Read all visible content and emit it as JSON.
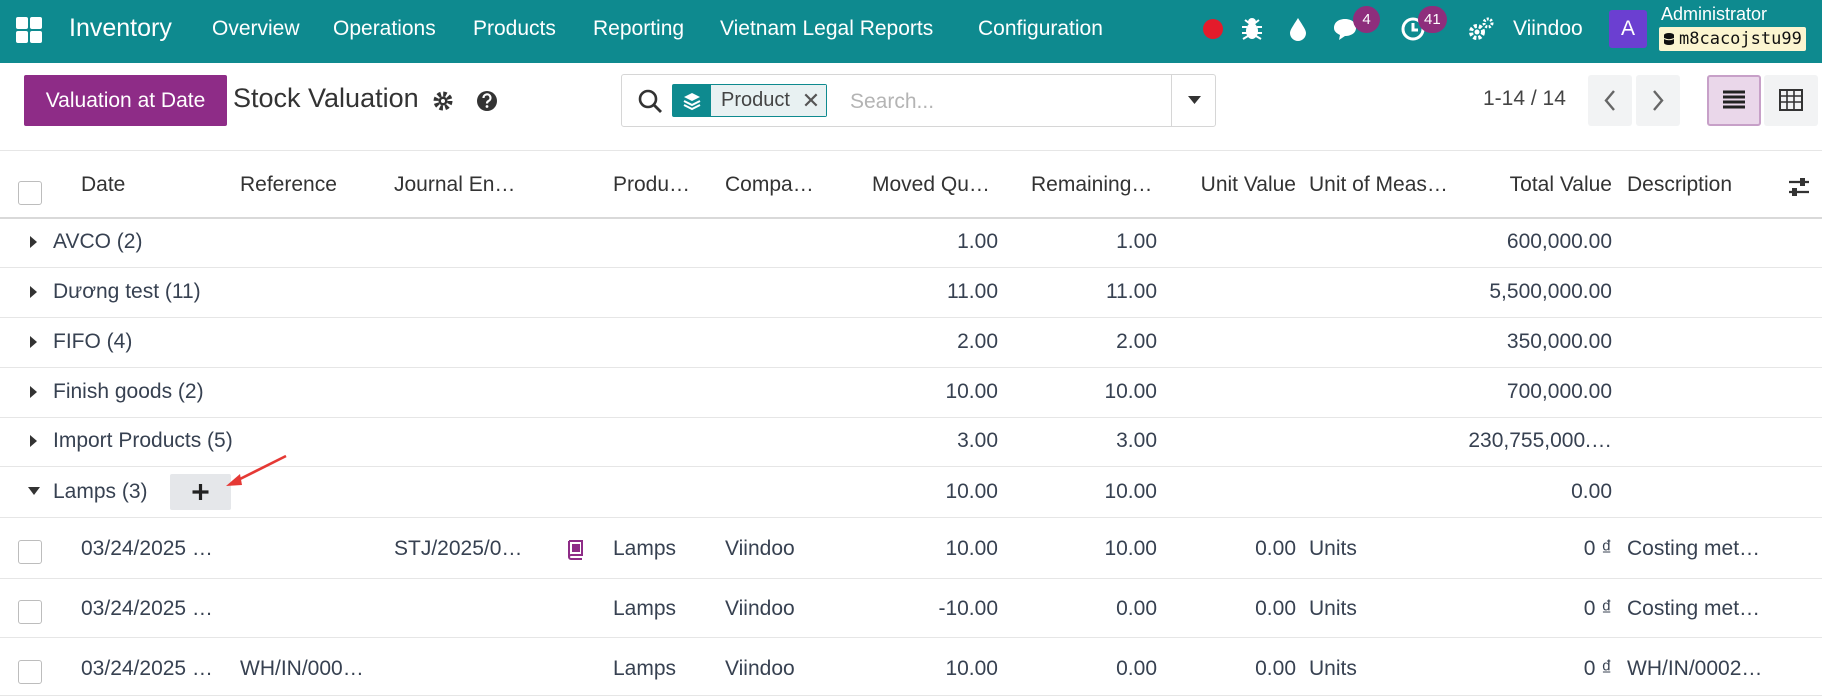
{
  "navbar": {
    "brand": "Inventory",
    "menu": [
      "Overview",
      "Operations",
      "Products",
      "Reporting",
      "Vietnam Legal Reports",
      "Configuration"
    ],
    "messages_badge": "4",
    "activities_badge": "41",
    "company": "Viindoo",
    "avatar_letter": "A",
    "user_name": "Administrator",
    "database": "m8cacojstu99"
  },
  "control": {
    "primary_button": "Valuation at Date",
    "breadcrumb": "Stock Valuation",
    "facet_value": "Product",
    "search_placeholder": "Search...",
    "pager": "1-14 / 14"
  },
  "table": {
    "headers": {
      "date": "Date",
      "reference": "Reference",
      "journal_entry": "Journal En…",
      "product": "Produ…",
      "company": "Compa…",
      "moved_qty": "Moved Qu…",
      "remaining": "Remaining…",
      "unit_value": "Unit Value",
      "uom": "Unit of Meas…",
      "total_value": "Total Value",
      "description": "Description"
    },
    "groups": [
      {
        "name": "AVCO (2)",
        "moved": "1.00",
        "remaining": "1.00",
        "total": "600,000.00"
      },
      {
        "name": "Dương test (11)",
        "moved": "11.00",
        "remaining": "11.00",
        "total": "5,500,000.00"
      },
      {
        "name": "FIFO (4)",
        "moved": "2.00",
        "remaining": "2.00",
        "total": "350,000.00"
      },
      {
        "name": "Finish goods (2)",
        "moved": "10.00",
        "remaining": "10.00",
        "total": "700,000.00"
      },
      {
        "name": "Import Products (5)",
        "moved": "3.00",
        "remaining": "3.00",
        "total": "230,755,000.…"
      },
      {
        "name": "Lamps (3)",
        "moved": "10.00",
        "remaining": "10.00",
        "total": "0.00"
      }
    ],
    "records": [
      {
        "date": "03/24/2025 …",
        "reference": "",
        "journal_entry": "STJ/2025/0…",
        "product": "Lamps",
        "company": "Viindoo",
        "moved": "10.00",
        "remaining": "10.00",
        "unit_value": "0.00",
        "uom": "Units",
        "total": "0 ₫",
        "description": "Costing met…"
      },
      {
        "date": "03/24/2025 …",
        "reference": "",
        "journal_entry": "",
        "product": "Lamps",
        "company": "Viindoo",
        "moved": "-10.00",
        "remaining": "0.00",
        "unit_value": "0.00",
        "uom": "Units",
        "total": "0 ₫",
        "description": "Costing met…"
      },
      {
        "date": "03/24/2025 …",
        "reference": "WH/IN/000…",
        "journal_entry": "",
        "product": "Lamps",
        "company": "Viindoo",
        "moved": "10.00",
        "remaining": "0.00",
        "unit_value": "0.00",
        "uom": "Units",
        "total": "0 ₫",
        "description": "WH/IN/0002…"
      }
    ]
  },
  "colors": {
    "navbar": "#0e8a8f",
    "primary": "#8e2c87",
    "badge": "#8e2e7c",
    "record_dot": "#e41b2b",
    "annotation_arrow": "#e53935"
  },
  "icons": [
    "apps-icon",
    "record-dot-icon",
    "bug-icon",
    "drop-icon",
    "chat-icon",
    "clock-icon",
    "settings-icon",
    "gear-icon",
    "help-icon",
    "search-icon",
    "layers-icon",
    "close-icon",
    "caret-down-icon",
    "chevron-left-icon",
    "chevron-right-icon",
    "list-view-icon",
    "pivot-view-icon",
    "column-settings-icon",
    "caret-right-icon",
    "plus-icon",
    "journal-book-icon",
    "arrow-annotation-icon"
  ]
}
